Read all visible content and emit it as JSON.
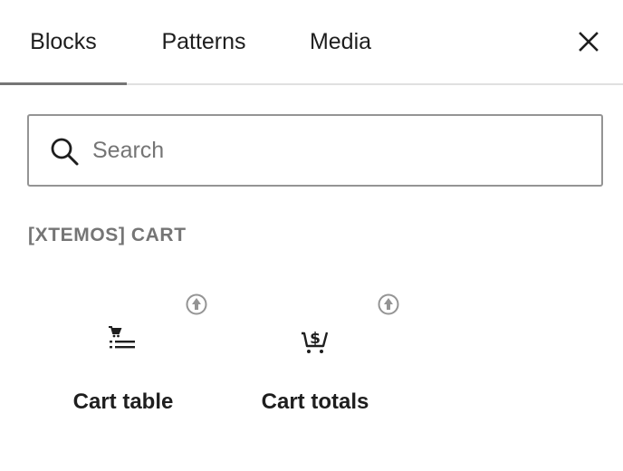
{
  "tabs": [
    {
      "label": "Blocks",
      "active": true
    },
    {
      "label": "Patterns",
      "active": false
    },
    {
      "label": "Media",
      "active": false
    }
  ],
  "search": {
    "placeholder": "Search",
    "value": ""
  },
  "category": {
    "title": "[XTEMOS] CART"
  },
  "blocks": [
    {
      "label": "Cart table",
      "icon": "cart-table-icon",
      "badge_icon": "xtemos-badge-icon"
    },
    {
      "label": "Cart totals",
      "icon": "cart-totals-icon",
      "badge_icon": "xtemos-badge-icon"
    }
  ],
  "colors": {
    "text": "#1e1e1e",
    "muted": "#757575",
    "border": "#949494",
    "divider": "#e0e0e0"
  }
}
